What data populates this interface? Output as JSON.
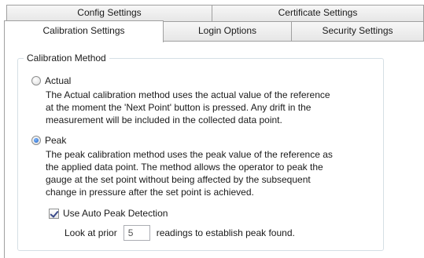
{
  "tabs": {
    "row1": [
      {
        "id": "config",
        "label": "Config Settings"
      },
      {
        "id": "cert",
        "label": "Certificate Settings"
      }
    ],
    "row2": [
      {
        "id": "calib",
        "label": "Calibration Settings",
        "active": true
      },
      {
        "id": "login",
        "label": "Login Options"
      },
      {
        "id": "security",
        "label": "Security Settings"
      }
    ]
  },
  "group": {
    "title": "Calibration Method",
    "options": [
      {
        "label": "Actual",
        "selected": false,
        "description_lines": [
          "The Actual calibration method uses the actual value of the reference",
          "at the moment the 'Next Point' button is pressed. Any drift in the",
          "measurement will be included in the collected data point."
        ]
      },
      {
        "label": "Peak",
        "selected": true,
        "description_lines": [
          "The peak calibration method uses the peak value of the reference as",
          "the applied data point. The method allows the operator to peak the",
          "gauge at the set point without being affected by the subsequent",
          "change in pressure after the set point is achieved."
        ]
      }
    ],
    "auto_peak": {
      "label": "Use Auto Peak Detection",
      "checked": true
    },
    "lookback": {
      "prefix": "Look at prior",
      "value": "5",
      "suffix": "readings to establish peak found."
    }
  }
}
